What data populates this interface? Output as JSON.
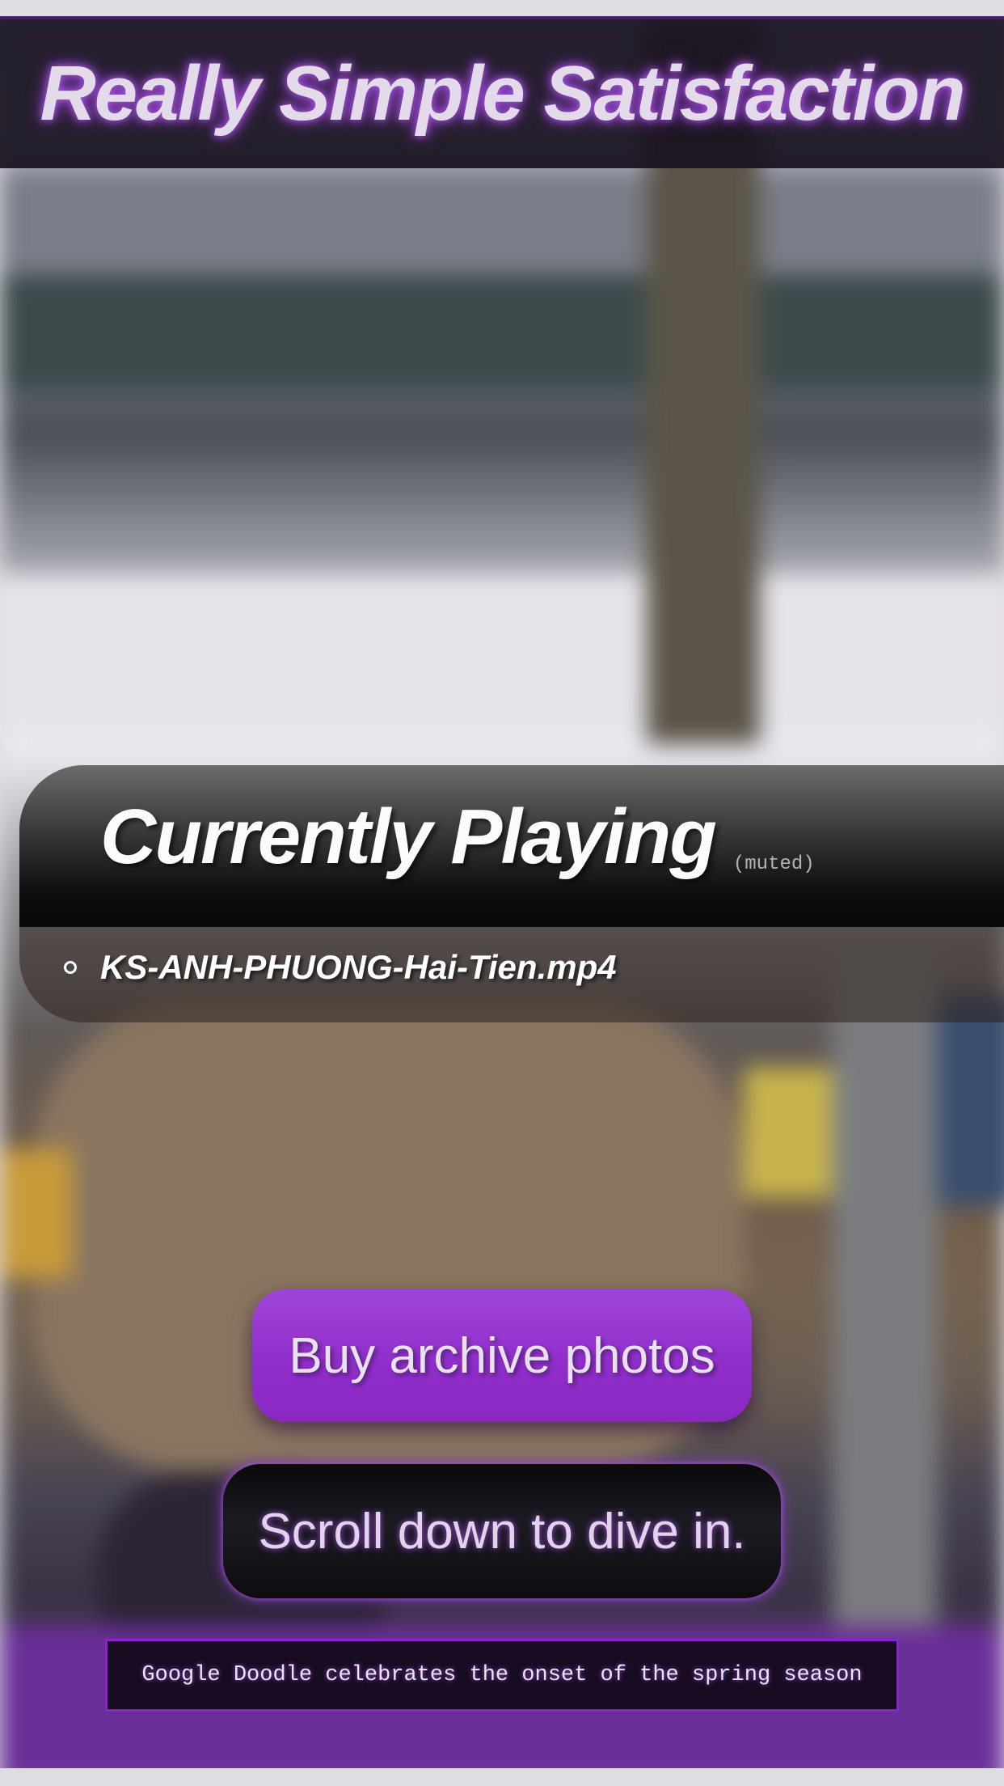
{
  "header": {
    "title": "Really Simple Satisfaction"
  },
  "now_playing": {
    "title": "Currently Playing",
    "status": "(muted)",
    "items": [
      {
        "label": "KS-ANH-PHUONG-Hai-Tien.mp4"
      }
    ]
  },
  "actions": {
    "buy_label": "Buy archive photos",
    "scroll_label": "Scroll down to dive in."
  },
  "news": {
    "text": "Google Doodle celebrates the onset of the spring season"
  },
  "colors": {
    "accent": "#8e2dc9",
    "glow": "#b35cf0",
    "header_bg": "#18121e"
  }
}
